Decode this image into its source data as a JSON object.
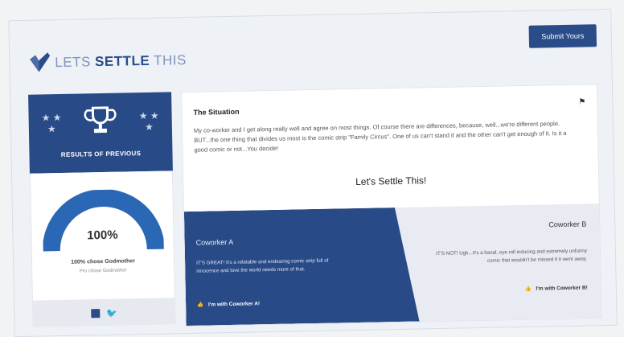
{
  "header": {
    "logo": {
      "part1": "LETS",
      "part2": "SETTLE",
      "part3": "THIS",
      "icon": "check-shield-icon"
    },
    "submit_label": "Submit Yours"
  },
  "sidebar": {
    "results_title": "RESULTS OF PREVIOUS",
    "results_icon": "trophy-icon",
    "gauge": {
      "value": 1.0,
      "percent_label": "100%"
    },
    "choice_line": "100% chose Godmother",
    "sub_line": "Pro chose Godmother",
    "social": {
      "facebook": "f",
      "twitter": "🐦"
    }
  },
  "situation": {
    "title": "The Situation",
    "text": "My co-worker and I get along really well and agree on most things. Of course there are differences, because, well...we're different people. BUT...the one thing that divides us most is the comic strip \"Family Circus\". One of us can't stand it and the other can't get enough of it. Is it a good comic or not...You decide!",
    "cta": "Let's Settle This!"
  },
  "coworker_a": {
    "name": "Coworker A",
    "desc": "IT'S GREAT! It's a relatable and endearing comic strip full of innocence and love the world needs more of that.",
    "button": "I'm with Coworker A!"
  },
  "coworker_b": {
    "name": "Coworker B",
    "desc": "IT'S NOT! Ugh...It's a banal, eye roll inducing and extremely unfunny comic that wouldn't be missed if it went away.",
    "button": "I'm with Coworker B!"
  },
  "colors": {
    "brand": "#2a4d8a",
    "panel_dark": "#284a87",
    "page_bg": "#eef1f6"
  }
}
